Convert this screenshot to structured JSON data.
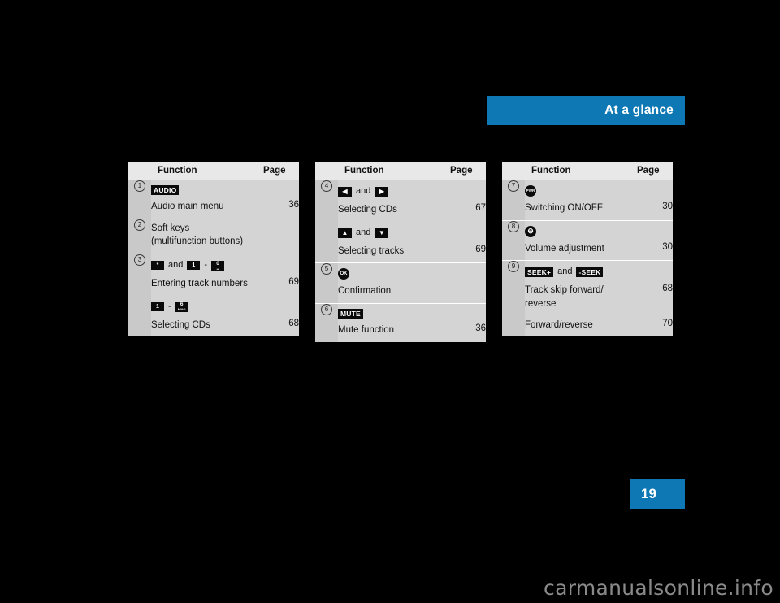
{
  "header": {
    "title": "At a glance",
    "accent_color": "#0d78b4"
  },
  "page_tab": {
    "number": "19"
  },
  "watermark": {
    "text": "carmanualsonline.info"
  },
  "columns": {
    "function": "Function",
    "page": "Page"
  },
  "words": {
    "and": "and",
    "dash": "-"
  },
  "tables": [
    {
      "id": "table-1",
      "rows": [
        {
          "ref": "1",
          "glyphs": [
            {
              "type": "label",
              "text": "AUDIO"
            }
          ],
          "label": "Audio main menu",
          "page": "36"
        },
        {
          "ref": "2",
          "glyphs": [],
          "label": "Soft keys\n(multifunction buttons)",
          "page": ""
        },
        {
          "ref": "3",
          "glyphs": [
            {
              "type": "small",
              "text": "*"
            },
            {
              "type": "word",
              "text": "and"
            },
            {
              "type": "small",
              "text": "1"
            },
            {
              "type": "word",
              "text": "-"
            },
            {
              "type": "numkey",
              "big": "0",
              "tiny": "␣"
            }
          ],
          "label": "Entering track numbers",
          "page": "69",
          "sub": {
            "glyphs": [
              {
                "type": "small",
                "text": "1"
              },
              {
                "type": "word",
                "text": "-"
              },
              {
                "type": "numkey",
                "big": "6",
                "tiny": "MNO"
              }
            ],
            "label": "Selecting CDs",
            "page": "68"
          }
        }
      ]
    },
    {
      "id": "table-2",
      "rows": [
        {
          "ref": "4",
          "glyphs": [
            {
              "type": "arrow",
              "text": "◀"
            },
            {
              "type": "word",
              "text": "and"
            },
            {
              "type": "arrow",
              "text": "▶"
            }
          ],
          "label": "Selecting CDs",
          "page": "67",
          "sub": {
            "glyphs": [
              {
                "type": "arrow",
                "text": "▲"
              },
              {
                "type": "word",
                "text": "and"
              },
              {
                "type": "arrow",
                "text": "▼"
              }
            ],
            "label": "Selecting tracks",
            "page": "69"
          }
        },
        {
          "ref": "5",
          "glyphs": [
            {
              "type": "round",
              "text": "OK"
            }
          ],
          "label": "Confirmation",
          "page": ""
        },
        {
          "ref": "6",
          "glyphs": [
            {
              "type": "label",
              "text": "MUTE"
            }
          ],
          "label": "Mute function",
          "page": "36"
        }
      ]
    },
    {
      "id": "table-3",
      "rows": [
        {
          "ref": "7",
          "glyphs": [
            {
              "type": "round-pwr",
              "text": "PWR"
            }
          ],
          "label": "Switching ON/OFF",
          "page": "30"
        },
        {
          "ref": "8",
          "glyphs": [
            {
              "type": "round-vol",
              "text": "⊖"
            }
          ],
          "label": "Volume adjustment",
          "page": "30"
        },
        {
          "ref": "9",
          "glyphs": [
            {
              "type": "label",
              "text": "SEEK+"
            },
            {
              "type": "word",
              "text": "and"
            },
            {
              "type": "label",
              "text": "-SEEK"
            }
          ],
          "label": "Track skip forward/\nreverse",
          "page": "68",
          "sub": {
            "glyphs": [],
            "label": "Forward/reverse",
            "page": "70"
          }
        }
      ]
    }
  ]
}
